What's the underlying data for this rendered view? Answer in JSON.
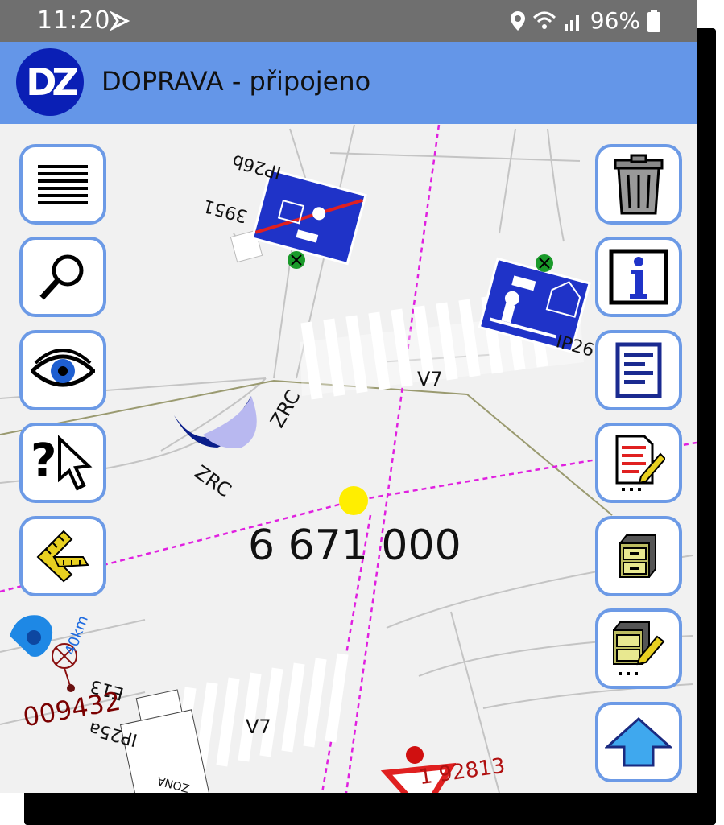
{
  "status_bar": {
    "time": "11:20",
    "battery": "96%"
  },
  "app_bar": {
    "logo_text": "DZ",
    "title": "DOPRAVA - připojeno"
  },
  "map": {
    "coordinate": "6 671 000",
    "road_labels": [
      "V7",
      "V7",
      "ZRC",
      "ZRC"
    ],
    "sign_labels": [
      "IP26b",
      "3951",
      "IP26",
      "E13",
      "IP25a",
      "ZONA"
    ],
    "distance_label": "40km",
    "object_codes": [
      "009432",
      "1 92813"
    ]
  },
  "buttons_left": [
    {
      "name": "menu-button",
      "icon": "menu-lines-icon"
    },
    {
      "name": "search-button",
      "icon": "magnifier-icon"
    },
    {
      "name": "view-button",
      "icon": "eye-icon"
    },
    {
      "name": "identify-button",
      "icon": "question-cursor-icon"
    },
    {
      "name": "measure-button",
      "icon": "ruler-square-icon"
    }
  ],
  "buttons_right": [
    {
      "name": "delete-button",
      "icon": "trash-icon"
    },
    {
      "name": "info-button",
      "icon": "info-icon"
    },
    {
      "name": "list-button",
      "icon": "document-list-icon"
    },
    {
      "name": "edit-button",
      "icon": "edit-document-icon"
    },
    {
      "name": "cabinet-button",
      "icon": "cabinet-icon"
    },
    {
      "name": "edit-cabinet-button",
      "icon": "cabinet-edit-icon"
    },
    {
      "name": "up-button",
      "icon": "arrow-up-icon"
    }
  ],
  "colors": {
    "status_bar": "#6f6f6f",
    "app_bar": "#6496e8",
    "button_border": "#6c9ae6",
    "logo": "#0a1fb5",
    "boundary": "#e020e0",
    "sign_blue": "#1f33c8",
    "code_red": "#7a0000",
    "position_dot": "#ffee00"
  }
}
